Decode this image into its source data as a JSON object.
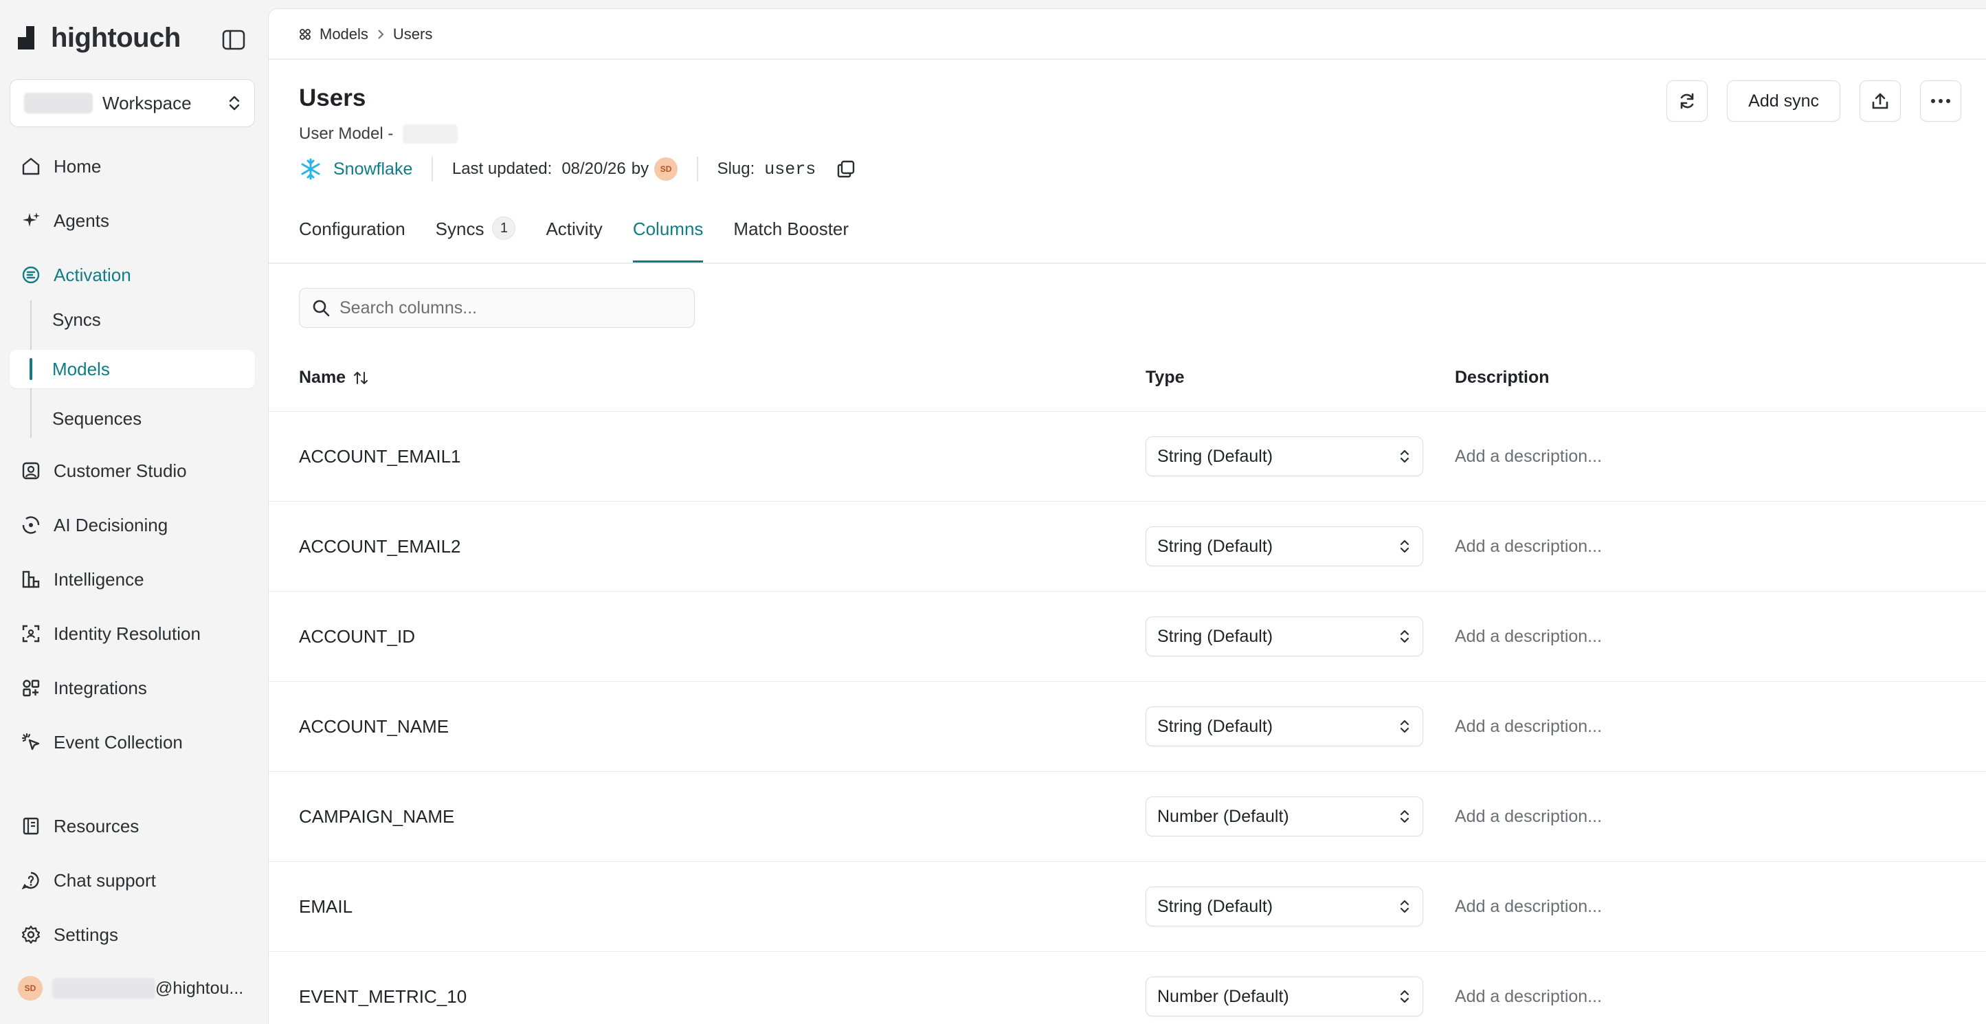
{
  "brand": {
    "name": "hightouch",
    "accent": "#0f7c86"
  },
  "workspace": {
    "label": "Workspace"
  },
  "nav": {
    "items": [
      {
        "label": "Home",
        "icon": "home-icon"
      },
      {
        "label": "Agents",
        "icon": "sparkle-icon"
      },
      {
        "label": "Activation",
        "icon": "activation-icon"
      }
    ],
    "sub_items": [
      {
        "label": "Syncs"
      },
      {
        "label": "Models"
      },
      {
        "label": "Sequences"
      }
    ],
    "more_items": [
      {
        "label": "Customer Studio",
        "icon": "customer-studio-icon"
      },
      {
        "label": "AI Decisioning",
        "icon": "ai-decisioning-icon"
      },
      {
        "label": "Intelligence",
        "icon": "chart-icon"
      },
      {
        "label": "Identity Resolution",
        "icon": "identity-icon"
      },
      {
        "label": "Integrations",
        "icon": "integrations-icon"
      },
      {
        "label": "Event Collection",
        "icon": "cursor-click-icon"
      }
    ],
    "bottom_items": [
      {
        "label": "Resources",
        "icon": "book-icon"
      },
      {
        "label": "Chat support",
        "icon": "help-icon"
      },
      {
        "label": "Settings",
        "icon": "gear-icon"
      }
    ],
    "user": {
      "initials": "SD",
      "email": "@hightou..."
    }
  },
  "breadcrumb": {
    "parent": "Models",
    "current": "Users"
  },
  "page": {
    "title": "Users",
    "subtitle": "User Model -",
    "source": "Snowflake",
    "last_updated_label": "Last updated:",
    "last_updated_value": "08/20/26",
    "by_label": "by",
    "author_initials": "SD",
    "slug_label": "Slug:",
    "slug_value": "users"
  },
  "actions": {
    "add_sync": "Add sync"
  },
  "tabs": [
    {
      "label": "Configuration"
    },
    {
      "label": "Syncs",
      "badge": "1"
    },
    {
      "label": "Activity"
    },
    {
      "label": "Columns"
    },
    {
      "label": "Match Booster"
    }
  ],
  "search": {
    "placeholder": "Search columns..."
  },
  "table": {
    "headers": {
      "name": "Name",
      "type": "Type",
      "description": "Description"
    },
    "description_placeholder": "Add a description...",
    "rows": [
      {
        "name": "ACCOUNT_EMAIL1",
        "type": "String (Default)"
      },
      {
        "name": "ACCOUNT_EMAIL2",
        "type": "String (Default)"
      },
      {
        "name": "ACCOUNT_ID",
        "type": "String (Default)"
      },
      {
        "name": "ACCOUNT_NAME",
        "type": "String (Default)"
      },
      {
        "name": "CAMPAIGN_NAME",
        "type": "Number (Default)"
      },
      {
        "name": "EMAIL",
        "type": "String (Default)"
      },
      {
        "name": "EVENT_METRIC_10",
        "type": "Number (Default)"
      }
    ]
  }
}
